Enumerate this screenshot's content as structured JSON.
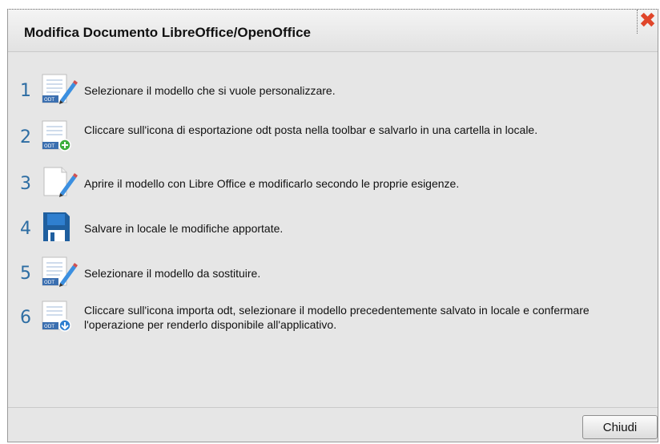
{
  "dialog": {
    "title": "Modifica Documento LibreOffice/OpenOffice",
    "close_glyph": "✖",
    "close_color": "#e0462a"
  },
  "steps": [
    {
      "number": "1",
      "icon": "odt-document-edit-icon",
      "badge": "ODT",
      "text": "Selezionare il modello che si vuole personalizzare."
    },
    {
      "number": "2",
      "icon": "odt-document-export-icon",
      "badge": "ODT",
      "text": "Cliccare sull'icona di esportazione odt posta nella toolbar e salvarlo in una cartella in locale."
    },
    {
      "number": "3",
      "icon": "blank-document-edit-icon",
      "text": "Aprire il modello con Libre Office e modificarlo secondo le proprie esigenze."
    },
    {
      "number": "4",
      "icon": "floppy-disk-icon",
      "text": "Salvare in locale le modifiche apportate."
    },
    {
      "number": "5",
      "icon": "odt-document-edit-icon",
      "badge": "ODT",
      "text": "Selezionare il modello da sostituire."
    },
    {
      "number": "6",
      "icon": "odt-document-import-icon",
      "badge": "ODT",
      "text": "Cliccare sull'icona importa odt, selezionare il modello precedentemente salvato in locale e confermare l'operazione per renderlo disponibile all'applicativo."
    }
  ],
  "footer": {
    "close_button_label": "Chiudi"
  },
  "colors": {
    "step_number": "#2d6da3",
    "odt_badge": "#3b6fb0",
    "export_circle": "#3cae3c",
    "import_circle": "#2f7fd0"
  }
}
